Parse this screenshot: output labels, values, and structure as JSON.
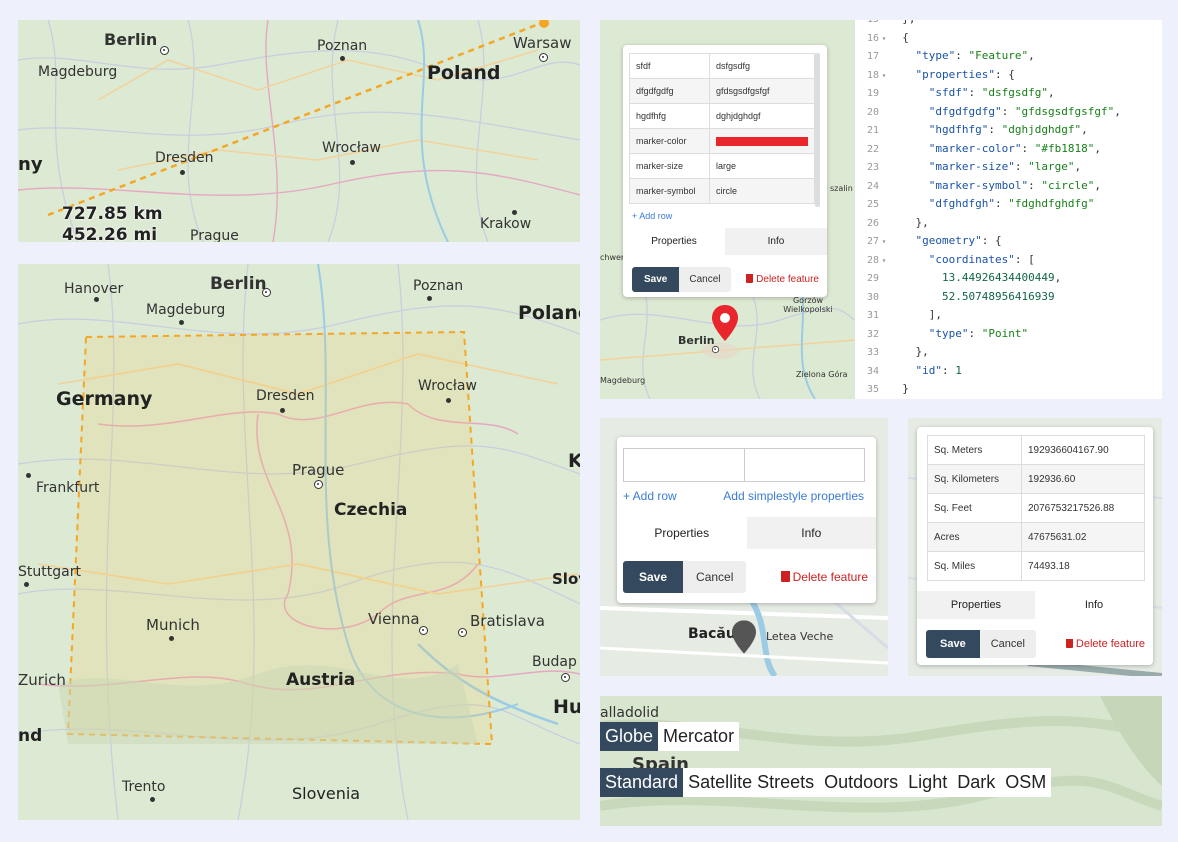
{
  "panel1": {
    "cities": [
      "Berlin",
      "Poznan",
      "Warsaw",
      "Magdeburg",
      "Dresden",
      "Wrocław",
      "Krakow",
      "Prague"
    ],
    "country": "Poland",
    "partial_label": "ny",
    "distance_km": "727.85 km",
    "distance_mi": "452.26 mi"
  },
  "panel2": {
    "cities": [
      "Hanover",
      "Berlin",
      "Poznan",
      "Magdeburg",
      "Dresden",
      "Wrocław",
      "Frankfurt",
      "Prague",
      "Stuttgart",
      "Munich",
      "Vienna",
      "Bratislava",
      "Zurich",
      "Trento",
      "Budap"
    ],
    "countries": [
      "Germany",
      "Czechia",
      "Austria",
      "Slovenia",
      "Polanc"
    ],
    "partial_labels": [
      "K",
      "Slov",
      "Hu",
      "nd"
    ]
  },
  "panel3": {
    "map_labels": [
      "Berlin",
      "Magdeburg",
      "Gorzów Wielkopolski",
      "Zielona Góra",
      "szalin",
      "chwer"
    ],
    "rows": [
      {
        "key": "sfdf",
        "value": "dsfgsdfg"
      },
      {
        "key": "dfgdfgdfg",
        "value": "gfdsgsdfgsfgf"
      },
      {
        "key": "hgdfhfg",
        "value": "dghjdghdgf"
      },
      {
        "key": "marker-color",
        "value": "#fb1818"
      },
      {
        "key": "marker-size",
        "value": "large"
      },
      {
        "key": "marker-symbol",
        "value": "circle"
      }
    ],
    "add_row": "+ Add row",
    "tab_properties": "Properties",
    "tab_info": "Info",
    "save": "Save",
    "cancel": "Cancel",
    "delete": "Delete feature",
    "marker_color": "#e8262b"
  },
  "code": {
    "lines": [
      {
        "n": "15",
        "f": "",
        "t": "  },"
      },
      {
        "n": "16",
        "f": "▾",
        "t": "  {"
      },
      {
        "n": "17",
        "f": "",
        "t": "    \"type\": \"Feature\","
      },
      {
        "n": "18",
        "f": "▾",
        "t": "    \"properties\": {"
      },
      {
        "n": "19",
        "f": "",
        "t": "      \"sfdf\": \"dsfgsdfg\","
      },
      {
        "n": "20",
        "f": "",
        "t": "      \"dfgdfgdfg\": \"gfdsgsdfgsfgf\","
      },
      {
        "n": "21",
        "f": "",
        "t": "      \"hgdfhfg\": \"dghjdghdgf\","
      },
      {
        "n": "22",
        "f": "",
        "t": "      \"marker-color\": \"#fb1818\","
      },
      {
        "n": "23",
        "f": "",
        "t": "      \"marker-size\": \"large\","
      },
      {
        "n": "24",
        "f": "",
        "t": "      \"marker-symbol\": \"circle\","
      },
      {
        "n": "25",
        "f": "",
        "t": "      \"dfghdfgh\": \"fdghdfghdfg\""
      },
      {
        "n": "26",
        "f": "",
        "t": "    },"
      },
      {
        "n": "27",
        "f": "▾",
        "t": "    \"geometry\": {"
      },
      {
        "n": "28",
        "f": "▾",
        "t": "      \"coordinates\": ["
      },
      {
        "n": "29",
        "f": "",
        "t": "        13.44926434400449,"
      },
      {
        "n": "30",
        "f": "",
        "t": "        52.50748956416939"
      },
      {
        "n": "31",
        "f": "",
        "t": "      ],"
      },
      {
        "n": "32",
        "f": "",
        "t": "      \"type\": \"Point\""
      },
      {
        "n": "33",
        "f": "",
        "t": "    },"
      },
      {
        "n": "34",
        "f": "",
        "t": "    \"id\": 1"
      },
      {
        "n": "35",
        "f": "",
        "t": "  }"
      }
    ]
  },
  "panel4": {
    "add_row": "+ Add row",
    "add_simplestyle": "Add simplestyle properties",
    "tab_properties": "Properties",
    "tab_info": "Info",
    "save": "Save",
    "cancel": "Cancel",
    "delete": "Delete feature",
    "map_labels": [
      "Bacău",
      "Letea Veche"
    ]
  },
  "panel5": {
    "rows": [
      {
        "key": "Sq. Meters",
        "value": "192936604167.90"
      },
      {
        "key": "Sq. Kilometers",
        "value": "192936.60"
      },
      {
        "key": "Sq. Feet",
        "value": "2076753217526.88"
      },
      {
        "key": "Acres",
        "value": "47675631.02"
      },
      {
        "key": "Sq. Miles",
        "value": "74493.18"
      }
    ],
    "tab_properties": "Properties",
    "tab_info": "Info",
    "save": "Save",
    "cancel": "Cancel",
    "delete": "Delete feature"
  },
  "panel6": {
    "projections": [
      "Globe",
      "Mercator"
    ],
    "active_projection": "Globe",
    "styles": [
      "Standard",
      "Satellite Streets",
      "Outdoors",
      "Light",
      "Dark",
      "OSM"
    ],
    "active_style": "Standard",
    "map_labels": [
      "alladolid",
      "Spain"
    ]
  }
}
